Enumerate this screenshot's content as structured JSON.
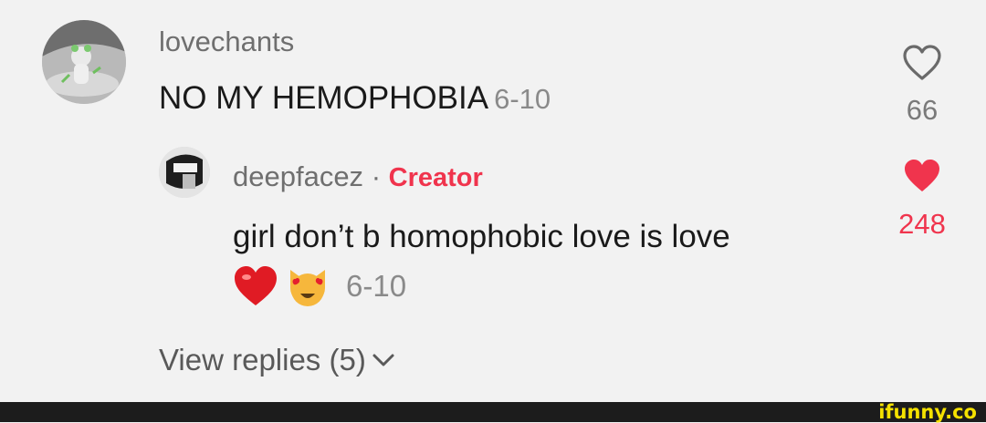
{
  "comment": {
    "username": "lovechants",
    "text": "NO MY HEMOPHOBIA",
    "date": "6-10",
    "like_count": "66"
  },
  "reply": {
    "username": "deepfacez",
    "separator": "·",
    "badge": "Creator",
    "text": "girl don’t b homophobic love is love",
    "date": "6-10",
    "like_count": "248",
    "emojis": [
      "heart-emoji",
      "heart-eyes-cat-emoji"
    ]
  },
  "view_replies": "View replies (5)",
  "watermark": "ifunny.co",
  "colors": {
    "background": "#f2f2f2",
    "accent": "#f0344d",
    "muted": "#8a8a8a",
    "footer": "#1c1c1c",
    "brand": "#f4e100"
  }
}
